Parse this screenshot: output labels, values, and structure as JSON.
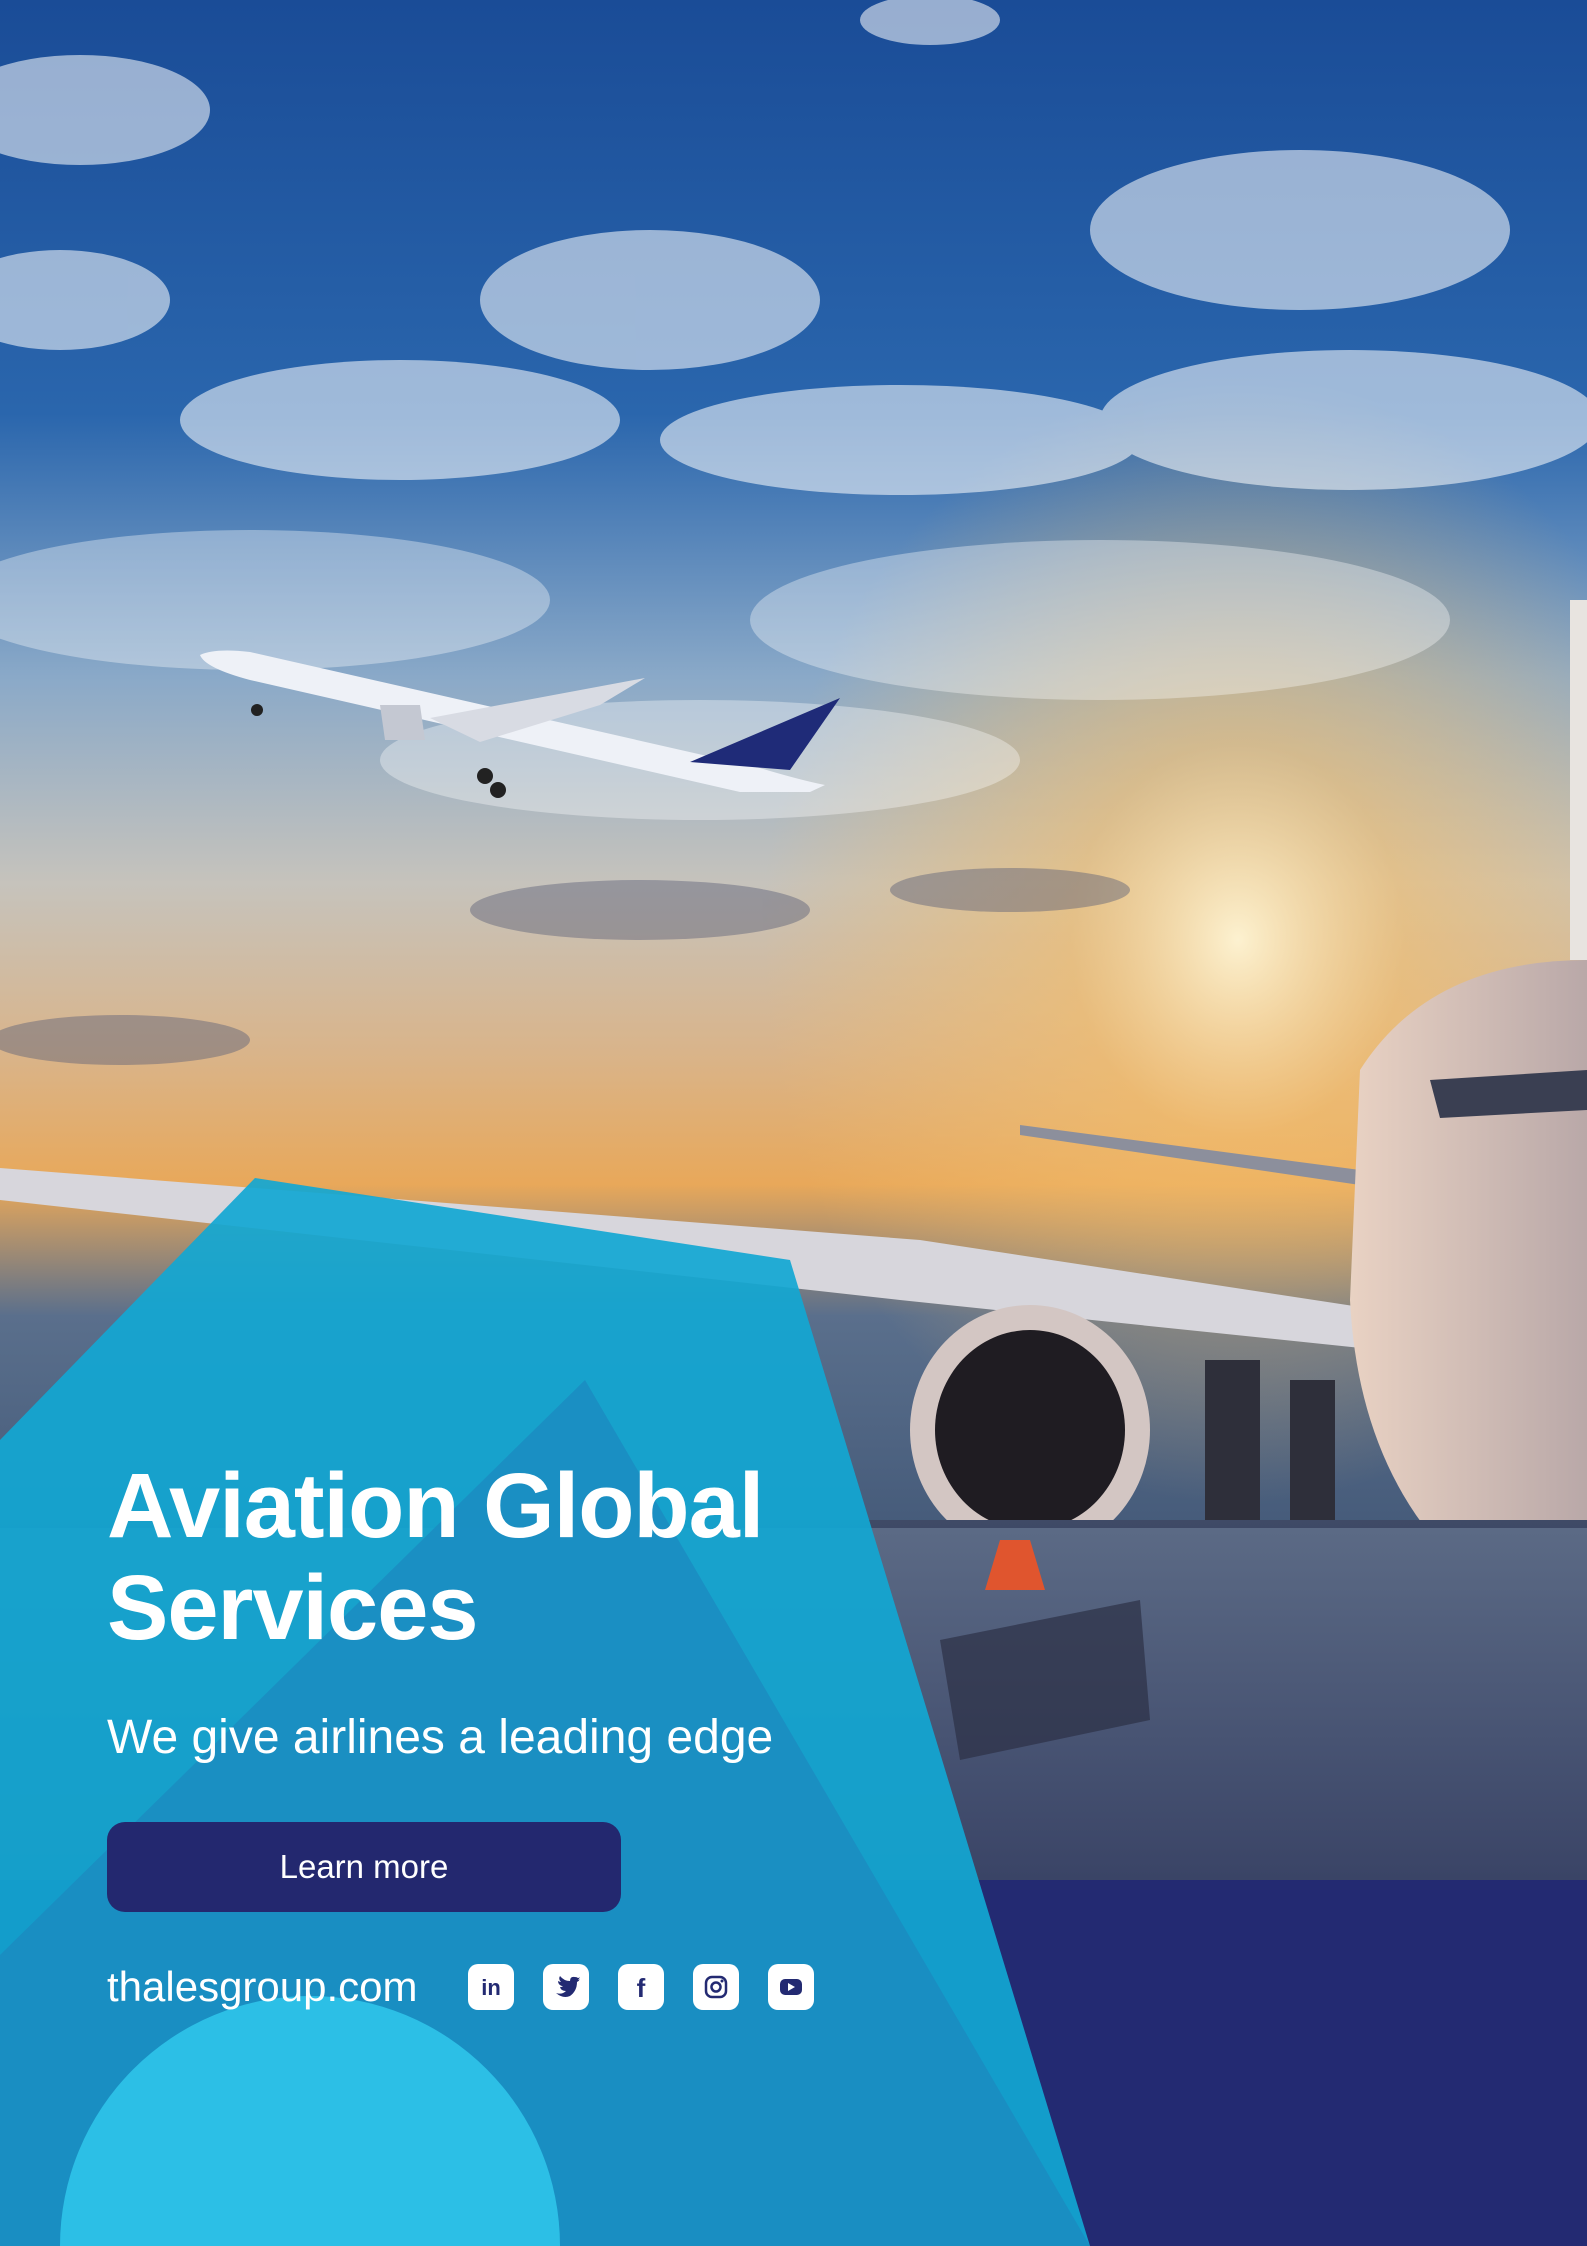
{
  "headline": [
    "Aviation Global",
    "Services"
  ],
  "tagline": "We give airlines a leading edge",
  "cta": {
    "label": "Learn more"
  },
  "footer": {
    "website": "thalesgroup.com",
    "social": [
      {
        "icon": "linkedin-icon",
        "glyph": "in"
      },
      {
        "icon": "twitter-icon"
      },
      {
        "icon": "facebook-icon",
        "glyph": "f"
      },
      {
        "icon": "instagram-icon"
      },
      {
        "icon": "youtube-icon"
      }
    ]
  },
  "colors": {
    "navy": "#232a72",
    "cyan": "#12a7d3",
    "light_cyan": "#2cbfe6",
    "mid_blue": "#1b8cc1",
    "sky_top": "#1b4f99",
    "sunset": "#e9a55a"
  }
}
